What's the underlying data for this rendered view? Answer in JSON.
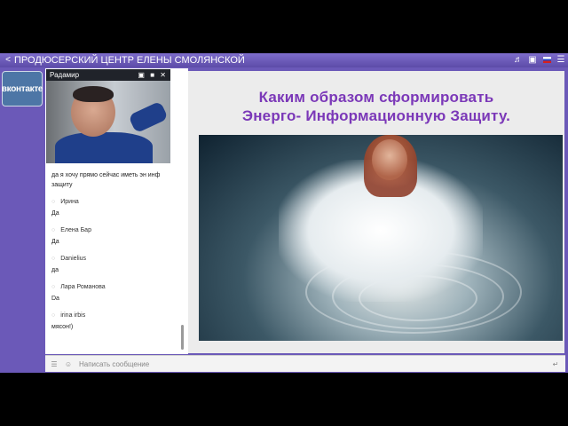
{
  "titlebar": {
    "title": "ПРОДЮСЕРСКИЙ ЦЕНТР ЕЛЕНЫ СМОЛЯНСКОЙ",
    "share_icon": "share-icon",
    "sound_icon": "speaker-icon",
    "fullscreen_icon": "fullscreen-icon",
    "lang_flag": "russian-flag-icon",
    "menu_icon": "hamburger-menu-icon"
  },
  "sidebar": {
    "vk_label": "вконтакте"
  },
  "video": {
    "name": "Радамир",
    "icons": [
      "fullscreen-icon",
      "camera-icon",
      "close-icon"
    ]
  },
  "chat": {
    "messages": [
      {
        "author": "",
        "text": "да я хочу прямо сейчас иметь эн инф защиту"
      },
      {
        "author": "Ирина",
        "text": "Да"
      },
      {
        "author": "Елена Бар",
        "text": "Да"
      },
      {
        "author": "Danielius",
        "text": "да"
      },
      {
        "author": "Лара Романова",
        "text": "Da"
      },
      {
        "author": "irina irbis",
        "text": "мясон!)"
      }
    ]
  },
  "input": {
    "placeholder": "Написать сообщение"
  },
  "slide": {
    "heading_line1": "Каким образом сформировать",
    "heading_line2": "Энерго- Информационную Защиту."
  },
  "colors": {
    "window_bg": "#6b59b8",
    "heading": "#7b38b8",
    "vk_bg": "#4d76a6"
  }
}
